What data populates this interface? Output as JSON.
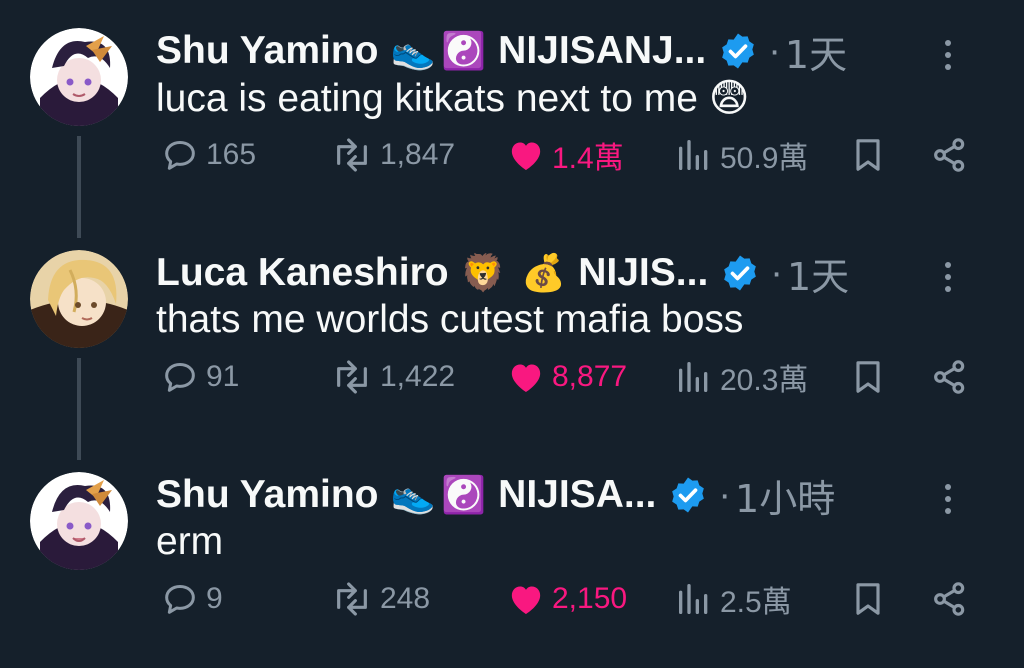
{
  "tweets": [
    {
      "author_name": "Shu Yamino",
      "emojis": [
        "👟",
        "☯️"
      ],
      "handle_display": "NIJISANJ...",
      "time": "1天",
      "text": "luca is eating kitkats next to me 😨",
      "replies": "165",
      "retweets": "1,847",
      "likes": "1.4萬",
      "views": "50.9萬"
    },
    {
      "author_name": "Luca Kaneshiro",
      "emojis": [
        "🦁",
        "💰"
      ],
      "handle_display": "NIJIS...",
      "time": "1天",
      "text": "thats me worlds cutest mafia boss",
      "replies": "91",
      "retweets": "1,422",
      "likes": "8,877",
      "views": "20.3萬"
    },
    {
      "author_name": "Shu Yamino",
      "emojis": [
        "👟",
        "☯️"
      ],
      "handle_display": "NIJISA...",
      "time": "1小時",
      "text": "erm",
      "replies": "9",
      "retweets": "248",
      "likes": "2,150",
      "views": "2.5萬"
    }
  ],
  "dot_separator": "·",
  "colors": {
    "background": "#15202b",
    "text_primary": "#f7f9f9",
    "text_secondary": "#8b98a5",
    "like": "#f91880",
    "verified": "#1d9bf0",
    "thread_line": "#3e4a56"
  },
  "icons": {
    "reply": "speech-bubble-icon",
    "retweet": "retweet-icon",
    "like": "heart-filled-icon",
    "views": "bar-chart-icon",
    "bookmark": "bookmark-icon",
    "share": "share-icon",
    "verified": "verified-badge-icon",
    "more": "more-vertical-icon"
  }
}
